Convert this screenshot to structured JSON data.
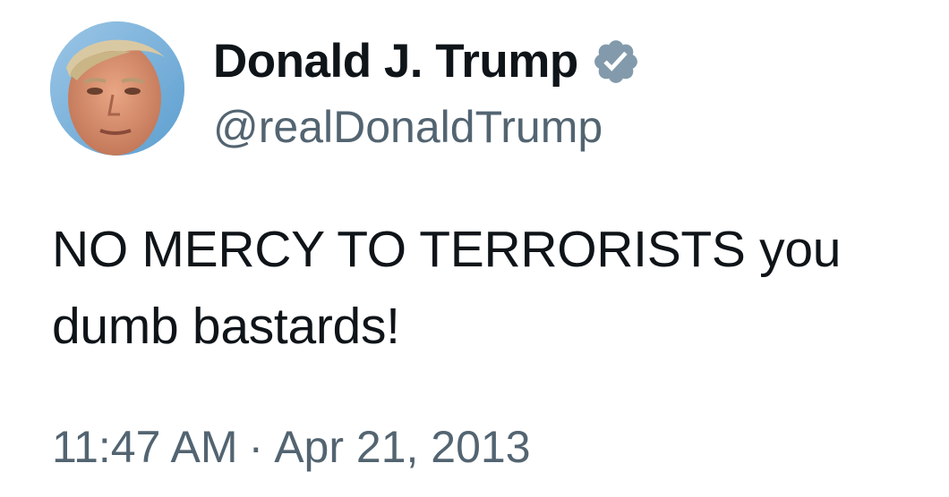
{
  "tweet": {
    "author": {
      "display_name": "Donald J. Trump",
      "handle": "@realDonaldTrump",
      "verified_badge_icon": "verified-badge-icon",
      "verified_badge_color": "#829aab",
      "avatar_icon": "profile-photo"
    },
    "text_line_1": "NO MERCY TO TERRORISTS you",
    "text_line_2": "dumb bastards!",
    "time": "11:47 AM",
    "separator": "·",
    "date": "Apr 21, 2013"
  },
  "colors": {
    "primary_text": "#0f1419",
    "secondary_text": "#536471",
    "background": "#ffffff"
  }
}
